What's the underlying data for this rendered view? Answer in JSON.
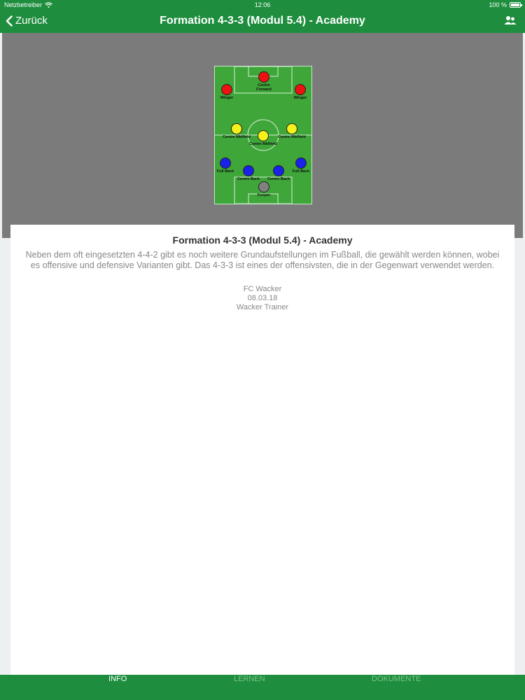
{
  "status_bar": {
    "carrier": "Netzbetreiber",
    "time": "12:06",
    "battery": "100 %"
  },
  "nav": {
    "back_label": "Zurück",
    "title": "Formation 4-3-3 (Modul 5.4) - Academy"
  },
  "formation": {
    "players": [
      {
        "label": "Centre Forward",
        "color": "#ee1111"
      },
      {
        "label": "Winger",
        "color": "#ee1111"
      },
      {
        "label": "Winger",
        "color": "#ee1111"
      },
      {
        "label": "Centre Midfield",
        "color": "#f5f21a"
      },
      {
        "label": "Centre Midfield",
        "color": "#f5f21a"
      },
      {
        "label": "Centre Midfield",
        "color": "#f5f21a"
      },
      {
        "label": "Full Back",
        "color": "#1a22e8"
      },
      {
        "label": "Centre Back",
        "color": "#1a22e8"
      },
      {
        "label": "Centre Back",
        "color": "#1a22e8"
      },
      {
        "label": "Full Back",
        "color": "#1a22e8"
      },
      {
        "label": "Keeper",
        "color": "#808080"
      }
    ]
  },
  "detail": {
    "title": "Formation 4-3-3 (Modul 5.4) - Academy",
    "description": "Neben dem oft eingesetzten 4-4-2 gibt es noch weitere Grundaufstellungen im Fußball, die gewählt werden können, wobei es offensive und defensive Varianten gibt. Das 4-3-3 ist eines der offensivsten, die in der Gegenwart verwendet werden.",
    "club": "FC Wacker",
    "date": "08.03.18",
    "author": "Wacker Trainer"
  },
  "tabs": [
    {
      "label": "INFO",
      "active": true
    },
    {
      "label": "LERNEN",
      "active": false
    },
    {
      "label": "DOKUMENTE",
      "active": false
    }
  ],
  "colors": {
    "brand_green": "#1e8e3e",
    "pitch_green": "#3fa63a"
  }
}
